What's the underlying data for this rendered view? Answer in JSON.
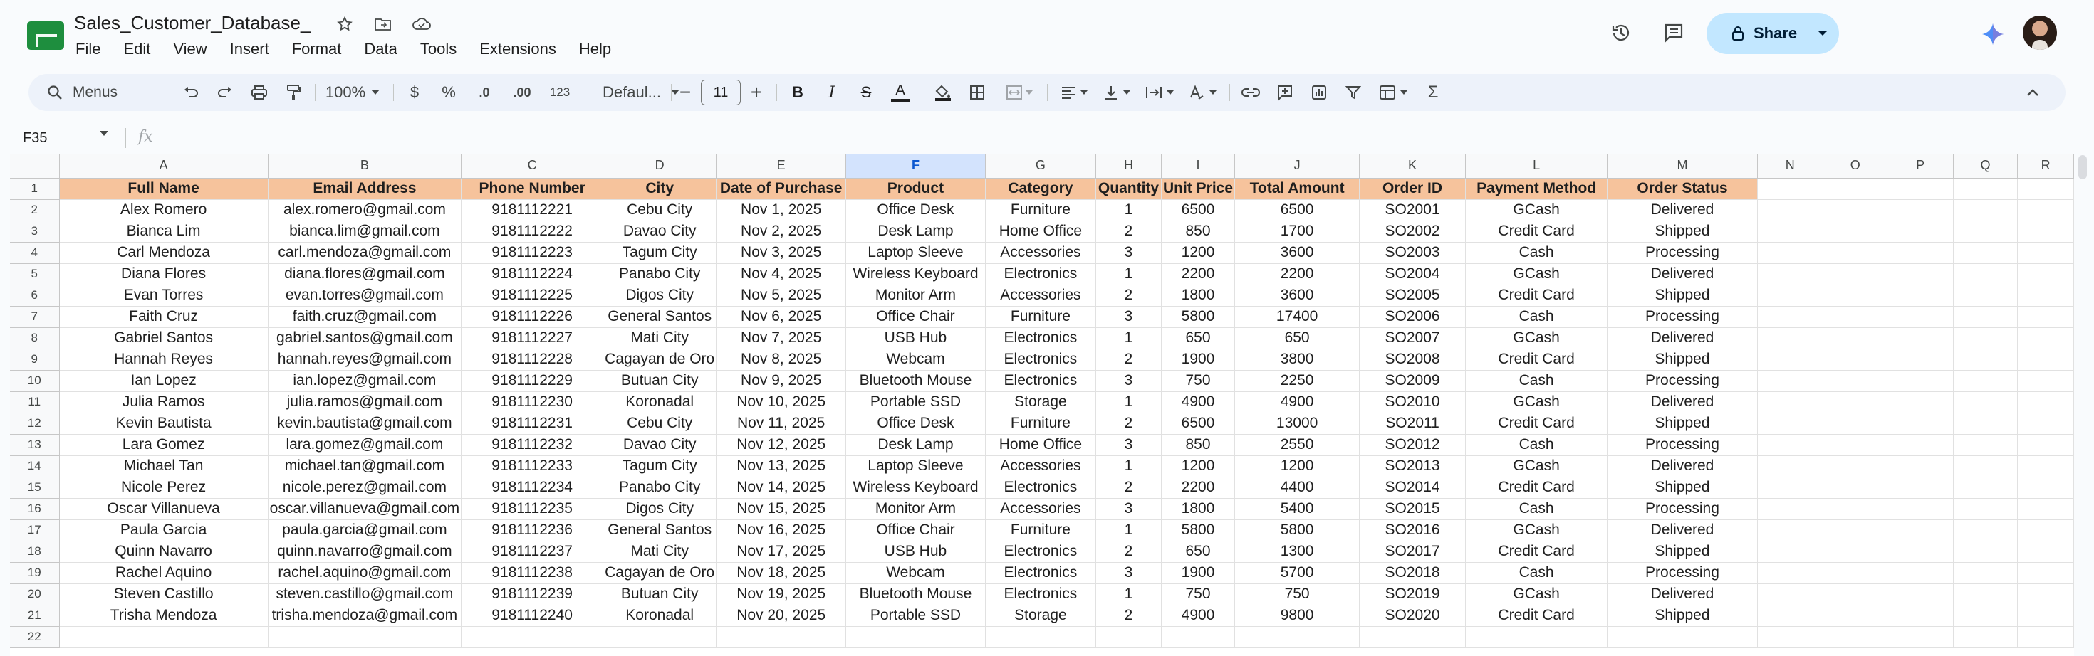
{
  "app": {
    "doc_title": "Sales_Customer_Database_",
    "menu": [
      "File",
      "Edit",
      "View",
      "Insert",
      "Format",
      "Data",
      "Tools",
      "Extensions",
      "Help"
    ],
    "share_label": "Share",
    "brand_color": "#1e8e3e",
    "share_color": "#c2e7ff"
  },
  "toolbar": {
    "search_label": "Menus",
    "zoom": "100%",
    "currency": "$",
    "percent": "%",
    "dec_decrease": ".0",
    "dec_increase": ".00",
    "number_format": "123",
    "font_name": "Defaul...",
    "font_size": "11"
  },
  "formula_bar": {
    "cell_ref": "F35",
    "fx": "fx",
    "content": ""
  },
  "sheet": {
    "columns": [
      "A",
      "B",
      "C",
      "D",
      "E",
      "F",
      "G",
      "H",
      "I",
      "J",
      "K",
      "L",
      "M",
      "N",
      "O",
      "P",
      "Q",
      "R"
    ],
    "selected_column": "F",
    "header_fill": "#f6c39c",
    "headers": [
      "Full Name",
      "Email Address",
      "Phone Number",
      "City",
      "Date of Purchase",
      "Product",
      "Category",
      "Quantity",
      "Unit Price",
      "Total Amount",
      "Order ID",
      "Payment Method",
      "Order Status"
    ],
    "rows": [
      [
        "Alex Romero",
        "alex.romero@gmail.com",
        "9181112221",
        "Cebu City",
        "Nov 1, 2025",
        "Office Desk",
        "Furniture",
        "1",
        "6500",
        "6500",
        "SO2001",
        "GCash",
        "Delivered"
      ],
      [
        "Bianca Lim",
        "bianca.lim@gmail.com",
        "9181112222",
        "Davao City",
        "Nov 2, 2025",
        "Desk Lamp",
        "Home Office",
        "2",
        "850",
        "1700",
        "SO2002",
        "Credit Card",
        "Shipped"
      ],
      [
        "Carl Mendoza",
        "carl.mendoza@gmail.com",
        "9181112223",
        "Tagum City",
        "Nov 3, 2025",
        "Laptop Sleeve",
        "Accessories",
        "3",
        "1200",
        "3600",
        "SO2003",
        "Cash",
        "Processing"
      ],
      [
        "Diana Flores",
        "diana.flores@gmail.com",
        "9181112224",
        "Panabo City",
        "Nov 4, 2025",
        "Wireless Keyboard",
        "Electronics",
        "1",
        "2200",
        "2200",
        "SO2004",
        "GCash",
        "Delivered"
      ],
      [
        "Evan Torres",
        "evan.torres@gmail.com",
        "9181112225",
        "Digos City",
        "Nov 5, 2025",
        "Monitor Arm",
        "Accessories",
        "2",
        "1800",
        "3600",
        "SO2005",
        "Credit Card",
        "Shipped"
      ],
      [
        "Faith Cruz",
        "faith.cruz@gmail.com",
        "9181112226",
        "General Santos",
        "Nov 6, 2025",
        "Office Chair",
        "Furniture",
        "3",
        "5800",
        "17400",
        "SO2006",
        "Cash",
        "Processing"
      ],
      [
        "Gabriel Santos",
        "gabriel.santos@gmail.com",
        "9181112227",
        "Mati City",
        "Nov 7, 2025",
        "USB Hub",
        "Electronics",
        "1",
        "650",
        "650",
        "SO2007",
        "GCash",
        "Delivered"
      ],
      [
        "Hannah Reyes",
        "hannah.reyes@gmail.com",
        "9181112228",
        "Cagayan de Oro",
        "Nov 8, 2025",
        "Webcam",
        "Electronics",
        "2",
        "1900",
        "3800",
        "SO2008",
        "Credit Card",
        "Shipped"
      ],
      [
        "Ian Lopez",
        "ian.lopez@gmail.com",
        "9181112229",
        "Butuan City",
        "Nov 9, 2025",
        "Bluetooth Mouse",
        "Electronics",
        "3",
        "750",
        "2250",
        "SO2009",
        "Cash",
        "Processing"
      ],
      [
        "Julia Ramos",
        "julia.ramos@gmail.com",
        "9181112230",
        "Koronadal",
        "Nov 10, 2025",
        "Portable SSD",
        "Storage",
        "1",
        "4900",
        "4900",
        "SO2010",
        "GCash",
        "Delivered"
      ],
      [
        "Kevin Bautista",
        "kevin.bautista@gmail.com",
        "9181112231",
        "Cebu City",
        "Nov 11, 2025",
        "Office Desk",
        "Furniture",
        "2",
        "6500",
        "13000",
        "SO2011",
        "Credit Card",
        "Shipped"
      ],
      [
        "Lara Gomez",
        "lara.gomez@gmail.com",
        "9181112232",
        "Davao City",
        "Nov 12, 2025",
        "Desk Lamp",
        "Home Office",
        "3",
        "850",
        "2550",
        "SO2012",
        "Cash",
        "Processing"
      ],
      [
        "Michael Tan",
        "michael.tan@gmail.com",
        "9181112233",
        "Tagum City",
        "Nov 13, 2025",
        "Laptop Sleeve",
        "Accessories",
        "1",
        "1200",
        "1200",
        "SO2013",
        "GCash",
        "Delivered"
      ],
      [
        "Nicole Perez",
        "nicole.perez@gmail.com",
        "9181112234",
        "Panabo City",
        "Nov 14, 2025",
        "Wireless Keyboard",
        "Electronics",
        "2",
        "2200",
        "4400",
        "SO2014",
        "Credit Card",
        "Shipped"
      ],
      [
        "Oscar Villanueva",
        "oscar.villanueva@gmail.com",
        "9181112235",
        "Digos City",
        "Nov 15, 2025",
        "Monitor Arm",
        "Accessories",
        "3",
        "1800",
        "5400",
        "SO2015",
        "Cash",
        "Processing"
      ],
      [
        "Paula Garcia",
        "paula.garcia@gmail.com",
        "9181112236",
        "General Santos",
        "Nov 16, 2025",
        "Office Chair",
        "Furniture",
        "1",
        "5800",
        "5800",
        "SO2016",
        "GCash",
        "Delivered"
      ],
      [
        "Quinn Navarro",
        "quinn.navarro@gmail.com",
        "9181112237",
        "Mati City",
        "Nov 17, 2025",
        "USB Hub",
        "Electronics",
        "2",
        "650",
        "1300",
        "SO2017",
        "Credit Card",
        "Shipped"
      ],
      [
        "Rachel Aquino",
        "rachel.aquino@gmail.com",
        "9181112238",
        "Cagayan de Oro",
        "Nov 18, 2025",
        "Webcam",
        "Electronics",
        "3",
        "1900",
        "5700",
        "SO2018",
        "Cash",
        "Processing"
      ],
      [
        "Steven Castillo",
        "steven.castillo@gmail.com",
        "9181112239",
        "Butuan City",
        "Nov 19, 2025",
        "Bluetooth Mouse",
        "Electronics",
        "1",
        "750",
        "750",
        "SO2019",
        "GCash",
        "Delivered"
      ],
      [
        "Trisha Mendoza",
        "trisha.mendoza@gmail.com",
        "9181112240",
        "Koronadal",
        "Nov 20, 2025",
        "Portable SSD",
        "Storage",
        "2",
        "4900",
        "9800",
        "SO2020",
        "Credit Card",
        "Shipped"
      ]
    ],
    "row_numbers": [
      "1",
      "2",
      "3",
      "4",
      "5",
      "6",
      "7",
      "8",
      "9",
      "10",
      "11",
      "12",
      "13",
      "14",
      "15",
      "16",
      "17",
      "18",
      "19",
      "20",
      "21",
      "22"
    ]
  }
}
